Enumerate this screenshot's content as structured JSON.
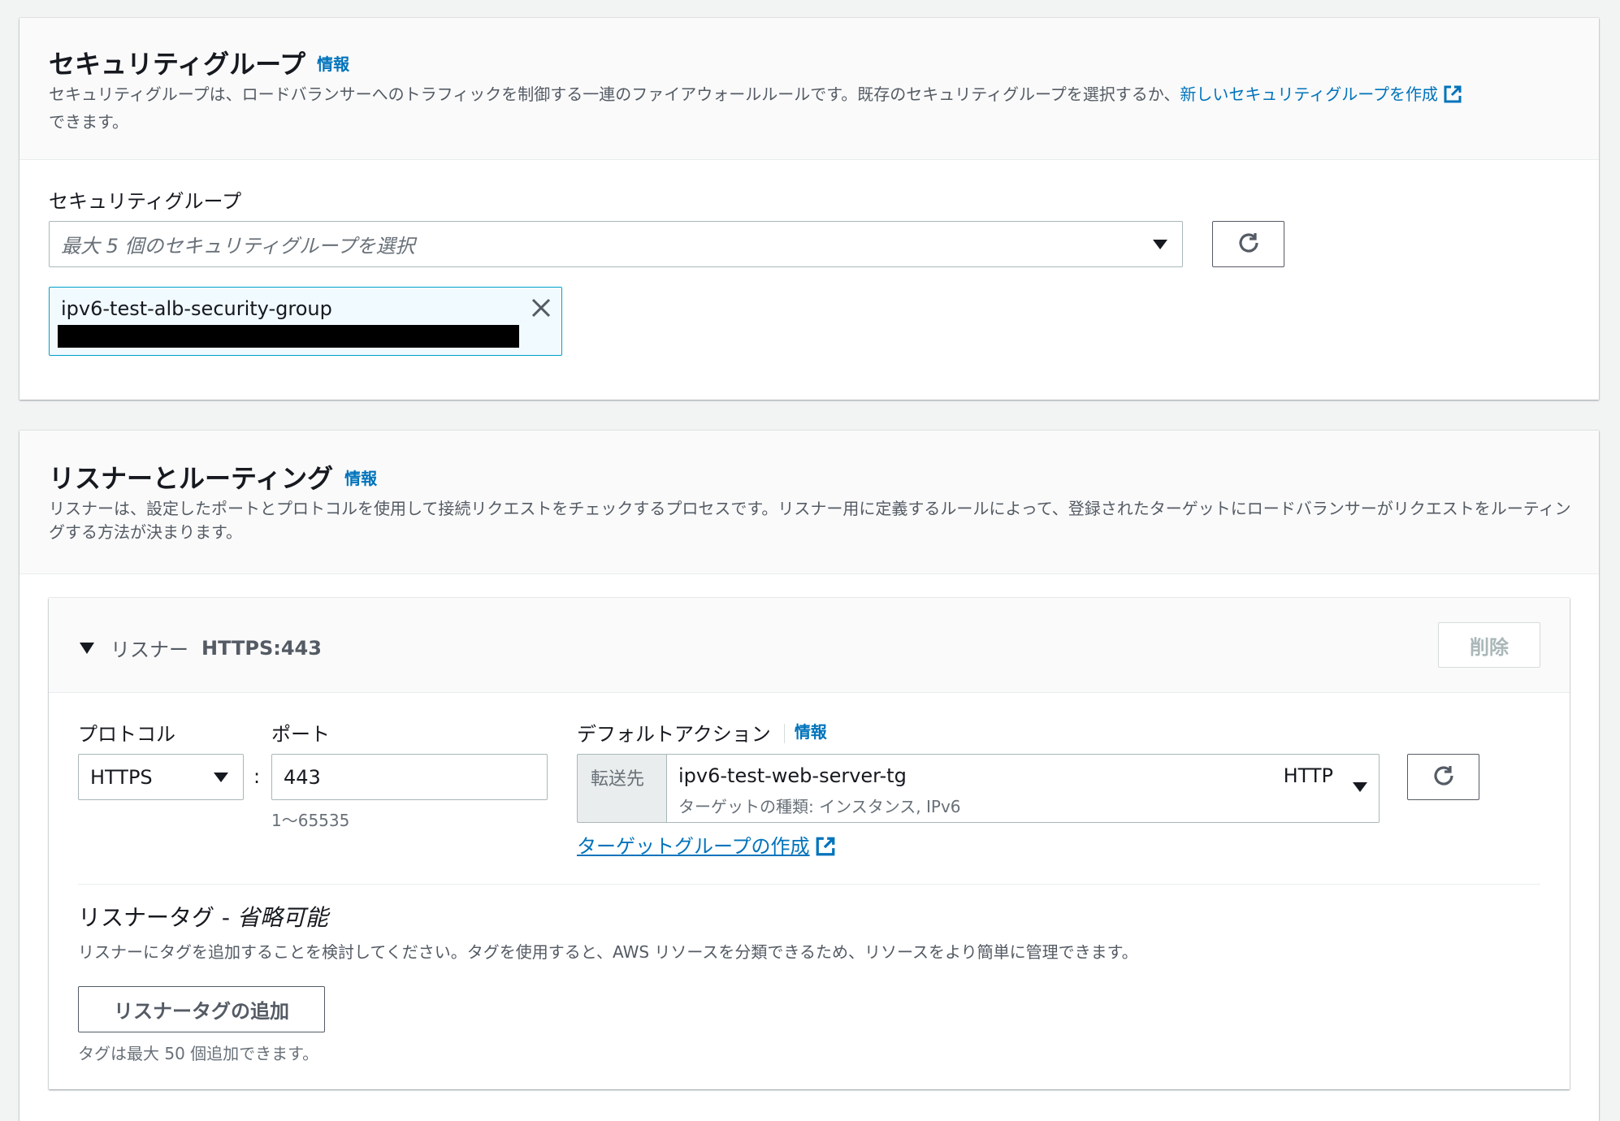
{
  "security": {
    "title": "セキュリティグループ",
    "info": "情報",
    "description_pre": "セキュリティグループは、ロードバランサーへのトラフィックを制御する一連のファイアウォールルールです。既存のセキュリティグループを選択するか、",
    "description_link": "新しいセキュリティグループを作成",
    "description_post": "できます。",
    "field_label": "セキュリティグループ",
    "select_placeholder": "最大 5 個のセキュリティグループを選択",
    "selected_token": "ipv6-test-alb-security-group"
  },
  "listeners": {
    "title": "リスナーとルーティング",
    "info": "情報",
    "description": "リスナーは、設定したポートとプロトコルを使用して接続リクエストをチェックするプロセスです。リスナー用に定義するルールによって、登録されたターゲットにロードバランサーがリクエストをルーティングする方法が決まります。",
    "listener": {
      "header_label": "リスナー",
      "header_value": "HTTPS:443",
      "remove_button": "削除",
      "protocol_label": "プロトコル",
      "protocol_value": "HTTPS",
      "colon": ":",
      "port_label": "ポート",
      "port_value": "443",
      "port_hint": "1〜65535",
      "default_action_label": "デフォルトアクション",
      "default_action_info": "情報",
      "forward_label": "転送先",
      "target_group_name": "ipv6-test-web-server-tg",
      "target_group_protocol": "HTTP",
      "target_group_detail": "ターゲットの種類: インスタンス, IPv6",
      "create_target_group_link": "ターゲットグループの作成",
      "tags_title": "リスナータグ - ",
      "tags_optional": "省略可能",
      "tags_description": "リスナーにタグを追加することを検討してください。タグを使用すると、AWS リソースを分類できるため、リソースをより簡単に管理できます。",
      "add_tag_button": "リスナータグの追加",
      "tags_limit": "タグは最大 50 個追加できます。"
    }
  },
  "colors": {
    "link": "#0073bb",
    "token_bg": "#f1faff",
    "token_border": "#00a1c9"
  }
}
